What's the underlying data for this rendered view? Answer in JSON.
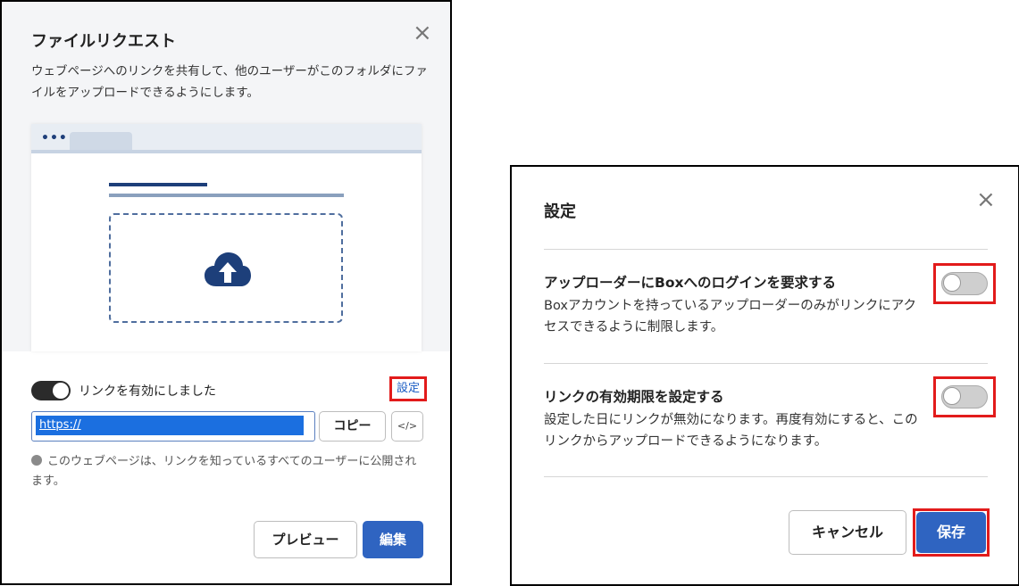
{
  "file_request": {
    "title": "ファイルリクエスト",
    "close_icon": "×",
    "description": "ウェブページへのリンクを共有して、他のユーザーがこのフォルダにファイルをアップロードできるようにします。",
    "illustration_dots": "•••",
    "link_toggle_state": "on",
    "link_enabled_label": "リンクを有効にしました",
    "settings_link": "設定",
    "url_value": "https://",
    "copy_label": "コピー",
    "embed_label": "</>",
    "public_note": "このウェブページは、リンクを知っているすべてのユーザーに公開されます。",
    "preview_label": "プレビュー",
    "edit_label": "編集"
  },
  "settings_dialog": {
    "title": "設定",
    "close_icon": "×",
    "items": [
      {
        "title": "アップローダーにBoxへのログインを要求する",
        "description": "Boxアカウントを持っているアップローダーのみがリンクにアクセスできるように制限します。",
        "toggle_state": "off"
      },
      {
        "title": "リンクの有効期限を設定する",
        "description": "設定した日にリンクが無効になります。再度有効にすると、このリンクからアップロードできるようになります。",
        "toggle_state": "off"
      }
    ],
    "cancel_label": "キャンセル",
    "save_label": "保存"
  },
  "colors": {
    "primary": "#2f64c1",
    "highlight_border": "#e21b1b",
    "link": "#1d5ec4"
  }
}
